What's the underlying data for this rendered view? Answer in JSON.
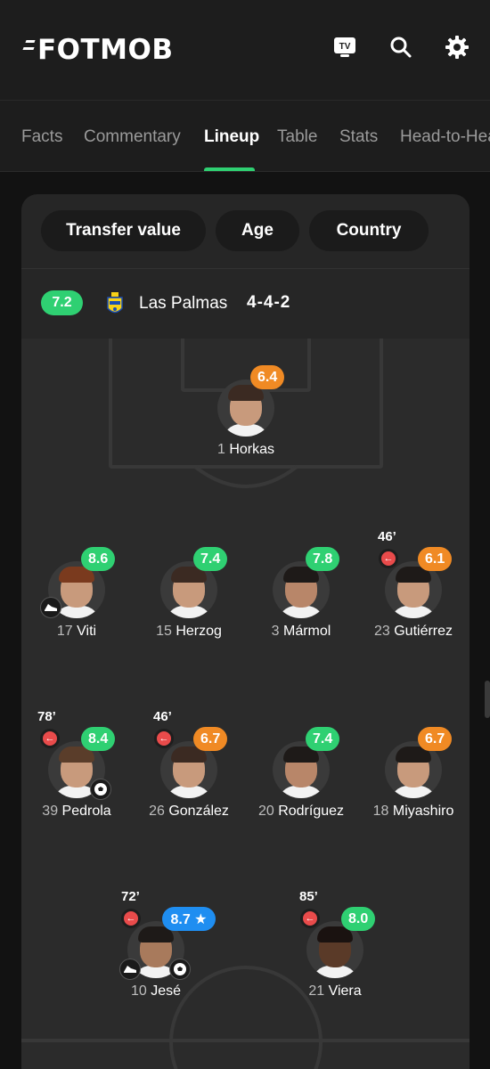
{
  "header": {
    "logo_text": "FOTMOB",
    "tv_label": "TV"
  },
  "tabs": [
    {
      "label": "Facts",
      "active": false
    },
    {
      "label": "Commentary",
      "active": false
    },
    {
      "label": "Lineup",
      "active": true
    },
    {
      "label": "Table",
      "active": false
    },
    {
      "label": "Stats",
      "active": false
    },
    {
      "label": "Head-to-Head",
      "active": false
    }
  ],
  "filters": {
    "transfer_value": "Transfer value",
    "age": "Age",
    "country": "Country"
  },
  "team": {
    "rating": "7.2",
    "name": "Las Palmas",
    "formation": "4-4-2"
  },
  "colors": {
    "accent": "#2fd072",
    "rating_green": "#2fd072",
    "rating_orange": "#f08a24",
    "rating_blue": "#1f8ef1",
    "sub_red": "#e94b4b"
  },
  "players": {
    "gk": {
      "number": "1",
      "name": "Horkas",
      "rating": "6.4"
    },
    "d1": {
      "number": "17",
      "name": "Viti",
      "rating": "8.6"
    },
    "d2": {
      "number": "15",
      "name": "Herzog",
      "rating": "7.4"
    },
    "d3": {
      "number": "3",
      "name": "Mármol",
      "rating": "7.8"
    },
    "d4": {
      "number": "23",
      "name": "Gutiérrez",
      "rating": "6.1",
      "sub_time": "46’"
    },
    "m1": {
      "number": "39",
      "name": "Pedrola",
      "rating": "8.4",
      "sub_time": "78’"
    },
    "m2": {
      "number": "26",
      "name": "González",
      "rating": "6.7",
      "sub_time": "46’"
    },
    "m3": {
      "number": "20",
      "name": "Rodríguez",
      "rating": "7.4"
    },
    "m4": {
      "number": "18",
      "name": "Miyashiro",
      "rating": "6.7"
    },
    "f1": {
      "number": "10",
      "name": "Jesé",
      "rating": "8.7 ★",
      "sub_time": "72’"
    },
    "f2": {
      "number": "21",
      "name": "Viera",
      "rating": "8.0",
      "sub_time": "85’"
    }
  }
}
